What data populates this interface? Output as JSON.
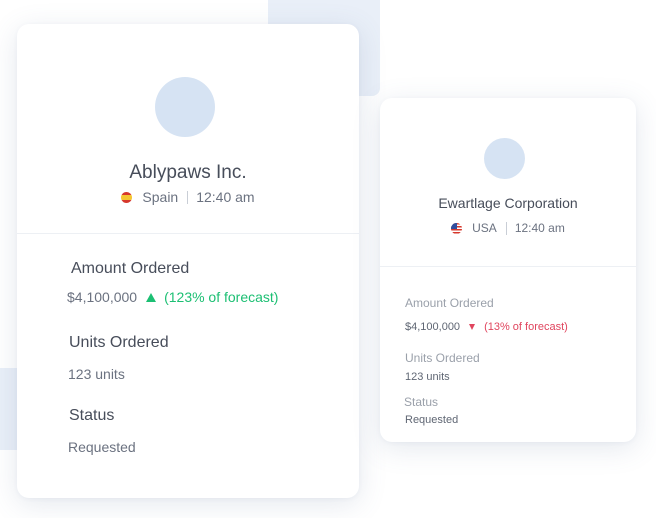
{
  "colors": {
    "positive": "#1cbf73",
    "negative": "#e0455e",
    "avatar": "#d6e3f3",
    "background_block": "#e9eff8"
  },
  "cards": [
    {
      "company": "Ablypaws Inc.",
      "flag_icon": "spain-flag-icon",
      "country": "Spain",
      "time": "12:40 am",
      "amount_label": "Amount Ordered",
      "amount_value": "$4,100,000",
      "trend_icon": "arrow-up-icon",
      "forecast": "(123% of forecast)",
      "units_label": "Units Ordered",
      "units_value": "123 units",
      "status_label": "Status",
      "status_value": "Requested"
    },
    {
      "company": "Ewartlage Corporation",
      "flag_icon": "usa-flag-icon",
      "country": "USA",
      "time": "12:40 am",
      "amount_label": "Amount Ordered",
      "amount_value": "$4,100,000",
      "trend_icon": "arrow-down-icon",
      "forecast": "(13% of forecast)",
      "units_label": "Units Ordered",
      "units_value": "123 units",
      "status_label": "Status",
      "status_value": "Requested"
    }
  ]
}
